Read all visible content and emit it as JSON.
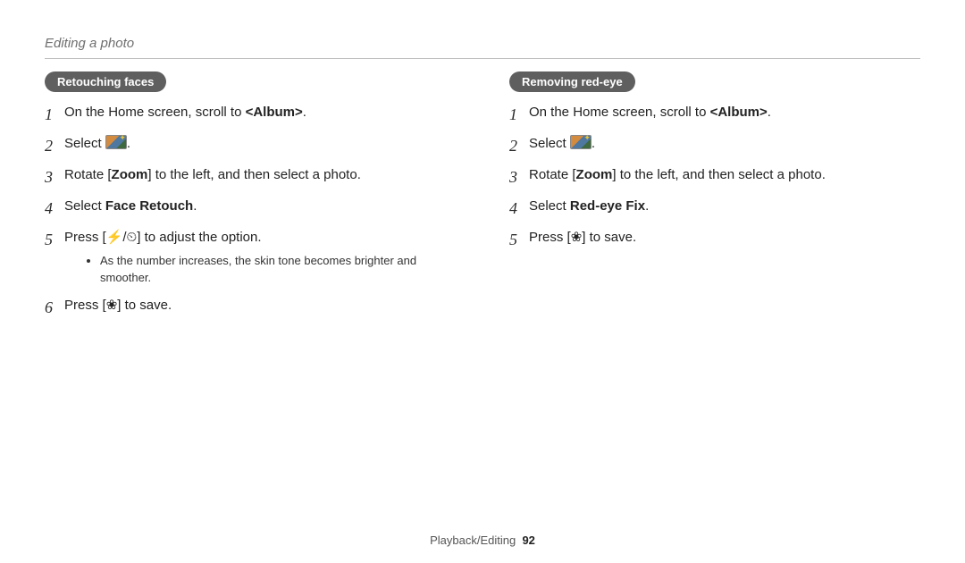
{
  "header": {
    "title": "Editing a photo"
  },
  "icons": {
    "flash": "⚡",
    "timer": "⏲",
    "macro": "❀"
  },
  "left": {
    "heading": "Retouching faces",
    "steps": [
      {
        "n": "1",
        "pre": "On the Home screen, scroll to ",
        "bold": "<Album>",
        "post": "."
      },
      {
        "n": "2",
        "pre": "Select ",
        "icon": "magic",
        "post": "."
      },
      {
        "n": "3",
        "pre": "Rotate [",
        "bold": "Zoom",
        "post": "] to the left, and then select a photo."
      },
      {
        "n": "4",
        "pre": "Select ",
        "bold": "Face Retouch",
        "post": "."
      },
      {
        "n": "5",
        "buttons": true
      },
      {
        "n": "6",
        "save": true
      }
    ],
    "step5_pre": "Press [",
    "step5_sep": "/",
    "step5_post": "] to adjust the option.",
    "sub": "As the number increases, the skin tone becomes brighter and smoother.",
    "save_pre": "Press [",
    "save_post": "] to save."
  },
  "right": {
    "heading": "Removing red-eye",
    "steps": [
      {
        "n": "1",
        "pre": "On the Home screen, scroll to ",
        "bold": "<Album>",
        "post": "."
      },
      {
        "n": "2",
        "pre": "Select ",
        "icon": "magic",
        "post": "."
      },
      {
        "n": "3",
        "pre": "Rotate [",
        "bold": "Zoom",
        "post": "] to the left, and then select a photo."
      },
      {
        "n": "4",
        "pre": "Select ",
        "bold": "Red-eye Fix",
        "post": "."
      },
      {
        "n": "5",
        "save": true
      }
    ],
    "save_pre": "Press [",
    "save_post": "] to save."
  },
  "footer": {
    "section": "Playback/Editing",
    "page": "92"
  }
}
